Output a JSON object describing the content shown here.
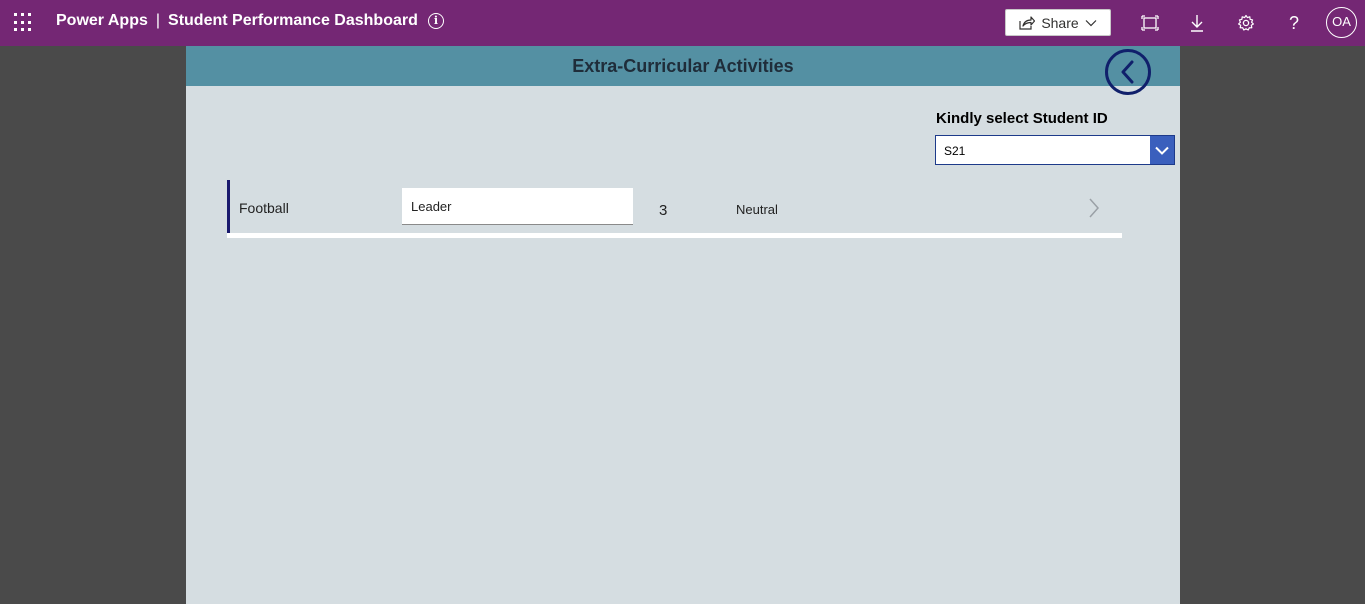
{
  "topbar": {
    "app_name": "Power Apps",
    "separator": "|",
    "app_title": "Student Performance Dashboard",
    "share_label": "Share",
    "user_initials": "OA",
    "icons": [
      "waffle-icon",
      "info-icon",
      "share-icon",
      "chevron-down-icon",
      "fit-screen-icon",
      "download-icon",
      "settings-icon",
      "help-icon"
    ]
  },
  "screen": {
    "title": "Extra-Curricular Activities",
    "back_icon": "chevron-left-icon"
  },
  "student_select": {
    "label": "Kindly select Student ID",
    "selected": "S21"
  },
  "gallery": {
    "rows": [
      {
        "activity": "Football",
        "role": "Leader",
        "count": "3",
        "mood": "Neutral"
      }
    ]
  },
  "colors": {
    "topbar": "#742774",
    "header_band": "#5490a3",
    "canvas": "#d5dde1",
    "accent": "#10206b",
    "dropdown_chevron": "#3a5fbd"
  }
}
